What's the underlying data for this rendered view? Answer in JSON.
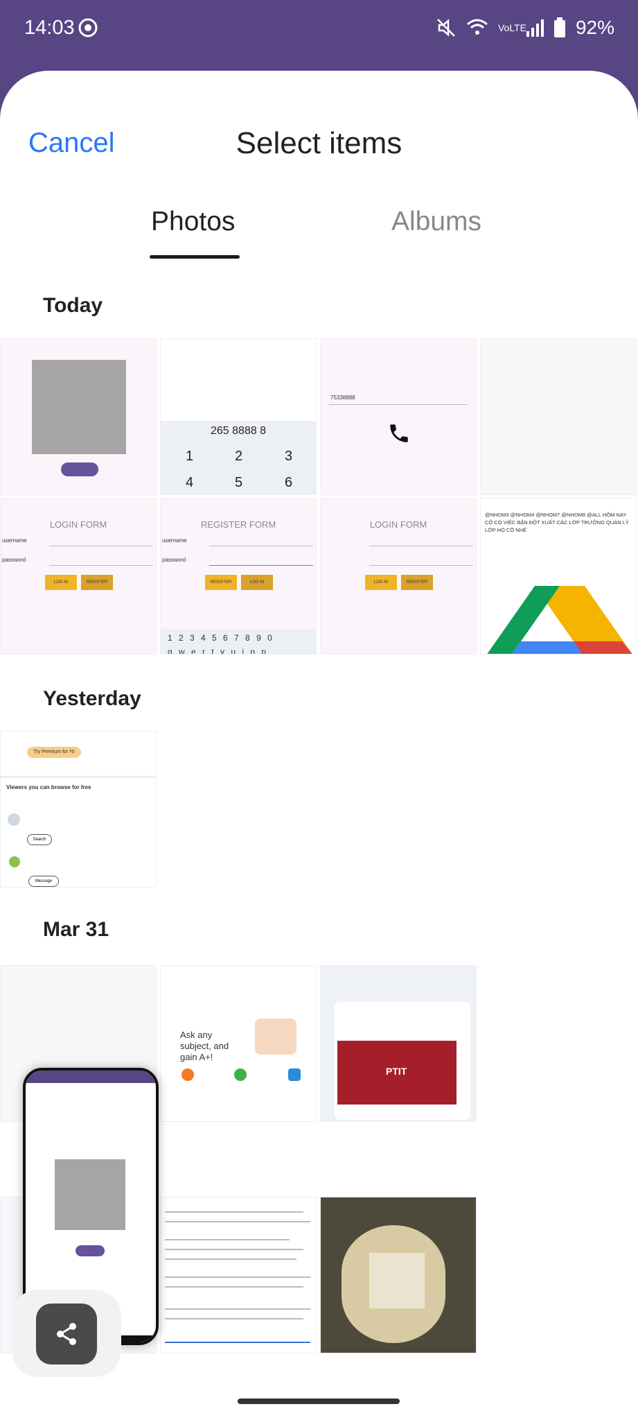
{
  "status": {
    "time": "14:03",
    "battery": "92%",
    "network": "VoLTE"
  },
  "header": {
    "cancel_label": "Cancel",
    "title": "Select items"
  },
  "tabs": {
    "photos": "Photos",
    "albums": "Albums"
  },
  "sections": {
    "today": "Today",
    "yesterday": "Yesterday",
    "mar31": "Mar 31"
  },
  "thumbs": {
    "dial_number": "265 8888 8",
    "dial_keys": [
      "1",
      "2",
      "3",
      "4",
      "5",
      "6"
    ],
    "login_form": "LOGIN FORM",
    "register_form": "REGISTER FORM",
    "username": "username",
    "password": "password",
    "login_btn": "LOG IN",
    "register_btn": "REGISTER",
    "viewers_title": "Viewers you can browse for free",
    "try_premium": "Try Premium for ₫0",
    "search": "Search",
    "message": "Message",
    "ask_any": "Ask any subject, and gain A+!",
    "phone_value": "75338888",
    "num_row": "1 2 3 4 5 6 7 8 9 0",
    "qwerty_row": "q w e r t y u i o p",
    "share_text": "@NHOM3 @NHOM4 @NHOM7 @NHOM8 @ALL HÔM NAY CÔ CÓ VIỆC BẬN ĐỘT XUẤT CÁC LỚP TRƯỞNG QUẢN LÝ LỚP HỘ CÔ NHÉ",
    "ptit_label": "PTIT"
  },
  "colors": {
    "accent": "#2a77f2",
    "statusbar": "#584584",
    "pill": "#66529d"
  }
}
